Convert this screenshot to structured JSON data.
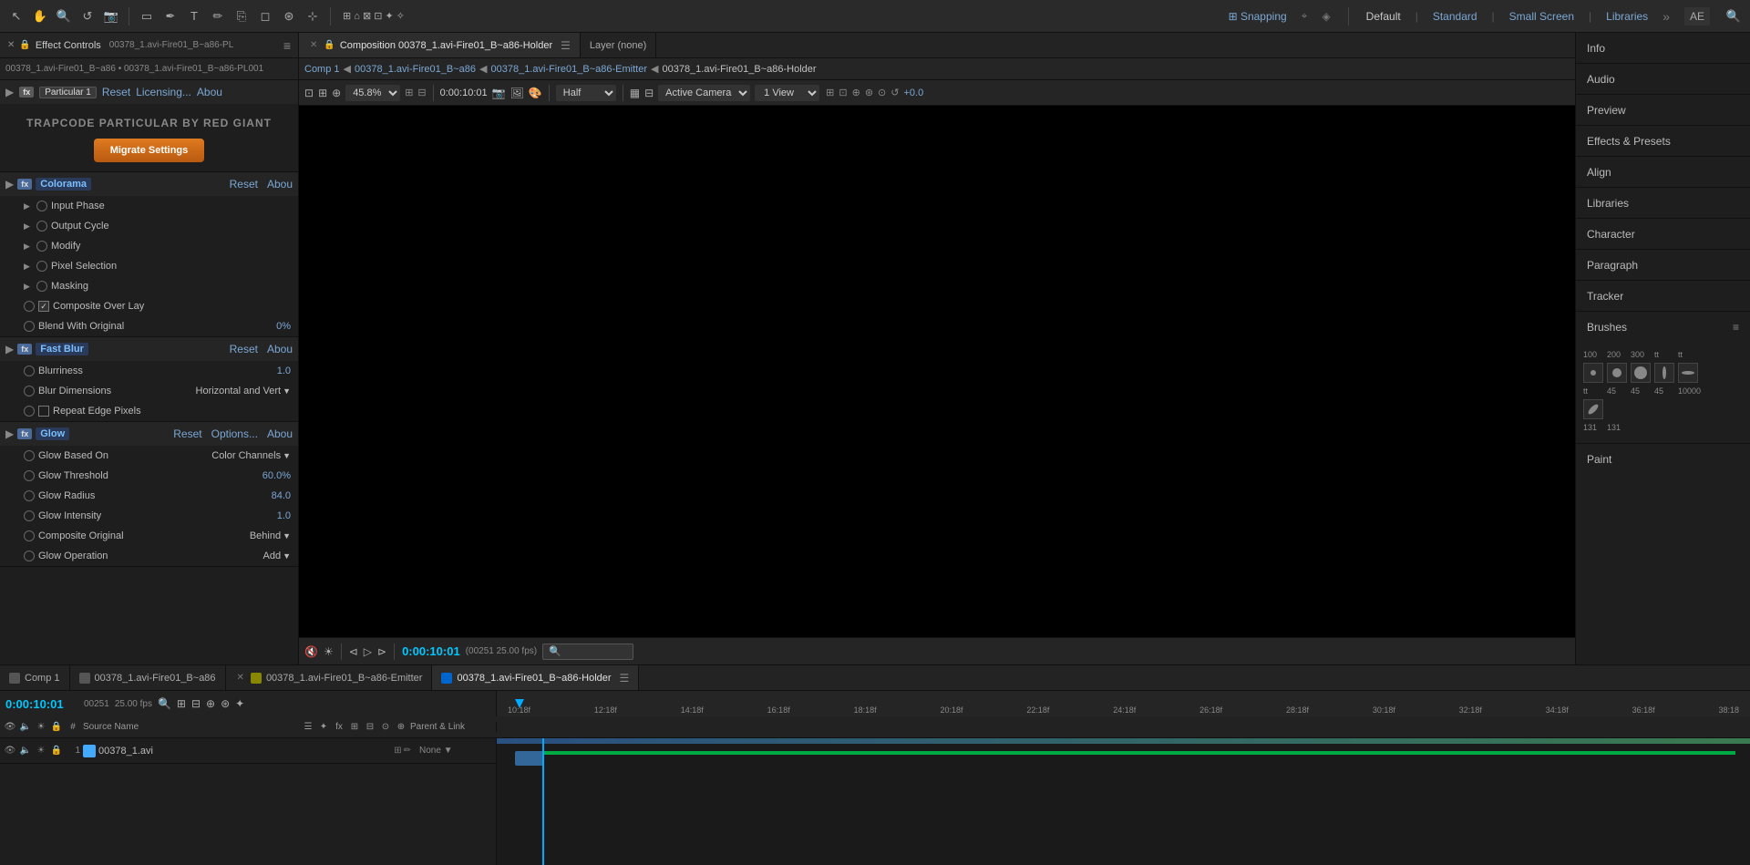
{
  "app": {
    "title": "Adobe After Effects"
  },
  "topToolbar": {
    "icons": [
      "arrow",
      "hand",
      "zoom",
      "rotate",
      "camera",
      "rectangle",
      "pen",
      "text",
      "brush",
      "clone",
      "eraser",
      "roto",
      "puppet"
    ],
    "snapping": "Snapping",
    "workspaces": [
      "Default",
      "Standard",
      "Small Screen",
      "Libraries"
    ],
    "activeWorkspace": "Default"
  },
  "effectControlsPanel": {
    "title": "Effect Controls",
    "tabLabel": "00378_1.avi-Fire01_B~a86-PL",
    "subLabel": "00378_1.avi-Fire01_B~a86 • 00378_1.avi-Fire01_B~a86-PL001",
    "particular": {
      "badge": "Particular 1",
      "resetLabel": "Reset",
      "licensingLabel": "Licensing...",
      "aboutLabel": "Abou",
      "banner": "TRAPCODE PARTICULAR BY RED GIANT",
      "migrateBtn": "Migrate Settings"
    },
    "colorama": {
      "name": "Colorama",
      "resetLabel": "Reset",
      "aboutLabel": "Abou",
      "rows": [
        {
          "label": "Input Phase",
          "type": "expandable"
        },
        {
          "label": "Output Cycle",
          "type": "expandable"
        },
        {
          "label": "Modify",
          "type": "expandable"
        },
        {
          "label": "Pixel Selection",
          "type": "expandable"
        },
        {
          "label": "Masking",
          "type": "expandable"
        },
        {
          "label": "Composite Over Lay",
          "type": "checkbox",
          "checked": true
        },
        {
          "label": "Blend With Original",
          "type": "value",
          "value": "0%"
        }
      ]
    },
    "fastBlur": {
      "name": "Fast Blur",
      "resetLabel": "Reset",
      "aboutLabel": "Abou",
      "rows": [
        {
          "label": "Blurriness",
          "type": "value",
          "value": "1.0"
        },
        {
          "label": "Blur Dimensions",
          "type": "dropdown",
          "value": "Horizontal and Vert"
        },
        {
          "label": "Repeat Edge Pixels",
          "type": "checkbox",
          "checked": false
        }
      ]
    },
    "glow": {
      "name": "Glow",
      "resetLabel": "Reset",
      "optionsLabel": "Options...",
      "aboutLabel": "Abou",
      "rows": [
        {
          "label": "Glow Based On",
          "type": "dropdown",
          "value": "Color Channels"
        },
        {
          "label": "Glow Threshold",
          "type": "value",
          "value": "60.0%"
        },
        {
          "label": "Glow Radius",
          "type": "value",
          "value": "84.0"
        },
        {
          "label": "Glow Intensity",
          "type": "value",
          "value": "1.0"
        },
        {
          "label": "Composite Original",
          "type": "dropdown",
          "value": "Behind"
        },
        {
          "label": "Glow Operation",
          "type": "dropdown",
          "value": "Add"
        }
      ]
    }
  },
  "viewerPanel": {
    "tabLabel": "Composition 00378_1.avi-Fire01_B~a86-Holder",
    "layerLabel": "Layer  (none)",
    "breadcrumbs": [
      "Comp 1",
      "00378_1.avi-Fire01_B~a86",
      "00378_1.avi-Fire01_B~a86-Emitter",
      "00378_1.avi-Fire01_B~a86-Holder"
    ],
    "zoom": "45.8%",
    "timecode": "0:00:10:01",
    "quality": "Half",
    "camera": "Active Camera",
    "view": "1 View",
    "greenValue": "+0.0",
    "bottomBar": {
      "time": "0:00:10:01",
      "fps": "25.00 fps",
      "frameCount": "00251"
    }
  },
  "rightPanel": {
    "items": [
      {
        "label": "Info",
        "id": "info"
      },
      {
        "label": "Audio",
        "id": "audio"
      },
      {
        "label": "Preview",
        "id": "preview"
      },
      {
        "label": "Effects & Presets",
        "id": "effects-presets"
      },
      {
        "label": "Align",
        "id": "align"
      },
      {
        "label": "Libraries",
        "id": "libraries"
      },
      {
        "label": "Character",
        "id": "character"
      },
      {
        "label": "Paragraph",
        "id": "paragraph"
      },
      {
        "label": "Tracker",
        "id": "tracker"
      },
      {
        "label": "Brushes",
        "id": "brushes"
      },
      {
        "label": "Paint",
        "id": "paint"
      }
    ],
    "brushes": {
      "sizes": [
        "100",
        "200",
        "300",
        "tt",
        "tt"
      ],
      "angles": [
        "tt",
        "45",
        "45",
        "45",
        "10000"
      ],
      "extraSizes": [
        "131",
        "131"
      ]
    }
  },
  "timeline": {
    "tabs": [
      {
        "label": "Comp 1",
        "color": "#555555",
        "active": false
      },
      {
        "label": "00378_1.avi-Fire01_B~a86",
        "color": "#555555",
        "active": false
      },
      {
        "label": "00378_1.avi-Fire01_B~a86-Emitter",
        "color": "#888800",
        "active": false
      },
      {
        "label": "00378_1.avi-Fire01_B~a86-Holder",
        "color": "#0066cc",
        "active": true
      }
    ],
    "time": "0:00:10:01",
    "fps": "25.00 fps",
    "frameCount": "00251",
    "rulerMarks": [
      "10:18f",
      "12:18f",
      "14:18f",
      "16:18f",
      "18:18f",
      "20:18f",
      "22:18f",
      "24:18f",
      "26:18f",
      "28:18f",
      "30:18f",
      "32:18f",
      "34:18f",
      "36:18f",
      "38:18"
    ],
    "columns": [
      "☁",
      "✦",
      "⚙",
      "#",
      "Source Name",
      "☰",
      "✦",
      "fx",
      "⊞",
      "⊟",
      "⊙",
      "⊕",
      "Parent & Link"
    ],
    "layers": [
      {
        "num": "1",
        "name": "00378_1.avi",
        "color": "#44aaff",
        "visible": true,
        "solo": false,
        "trackBarLeft": 0,
        "trackBarWidth": 100,
        "trackBarColor": "#336699"
      }
    ]
  }
}
